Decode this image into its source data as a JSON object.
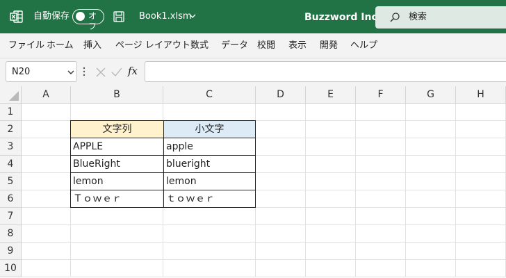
{
  "titlebar": {
    "autosave_label": "自動保存",
    "toggle_state": "オフ",
    "filename": "Book1.xlsm",
    "company": "Buzzword Inc.",
    "search_placeholder": "検索",
    "bg_color": "#217346"
  },
  "menu": {
    "items": [
      "ファイル",
      "ホーム",
      "挿入",
      "ページ レイアウト",
      "数式",
      "データ",
      "校閲",
      "表示",
      "開発",
      "ヘルプ"
    ]
  },
  "formula_bar": {
    "name_box": "N20",
    "fx_label": "fx",
    "formula": ""
  },
  "grid": {
    "columns": [
      "A",
      "B",
      "C",
      "D",
      "E",
      "F",
      "G",
      "H"
    ],
    "rows": [
      "1",
      "2",
      "3",
      "4",
      "5",
      "6",
      "7",
      "8",
      "9",
      "10"
    ],
    "table": {
      "header_b": "文字列",
      "header_c": "小文字",
      "header_b_color": "#fff2cc",
      "header_c_color": "#ddebf7",
      "rows": [
        [
          "APPLE",
          "apple"
        ],
        [
          "BlueRight",
          "blueright"
        ],
        [
          "lemon",
          "lemon"
        ],
        [
          "Ｔｏｗｅｒ",
          "ｔｏｗｅｒ"
        ]
      ]
    }
  }
}
